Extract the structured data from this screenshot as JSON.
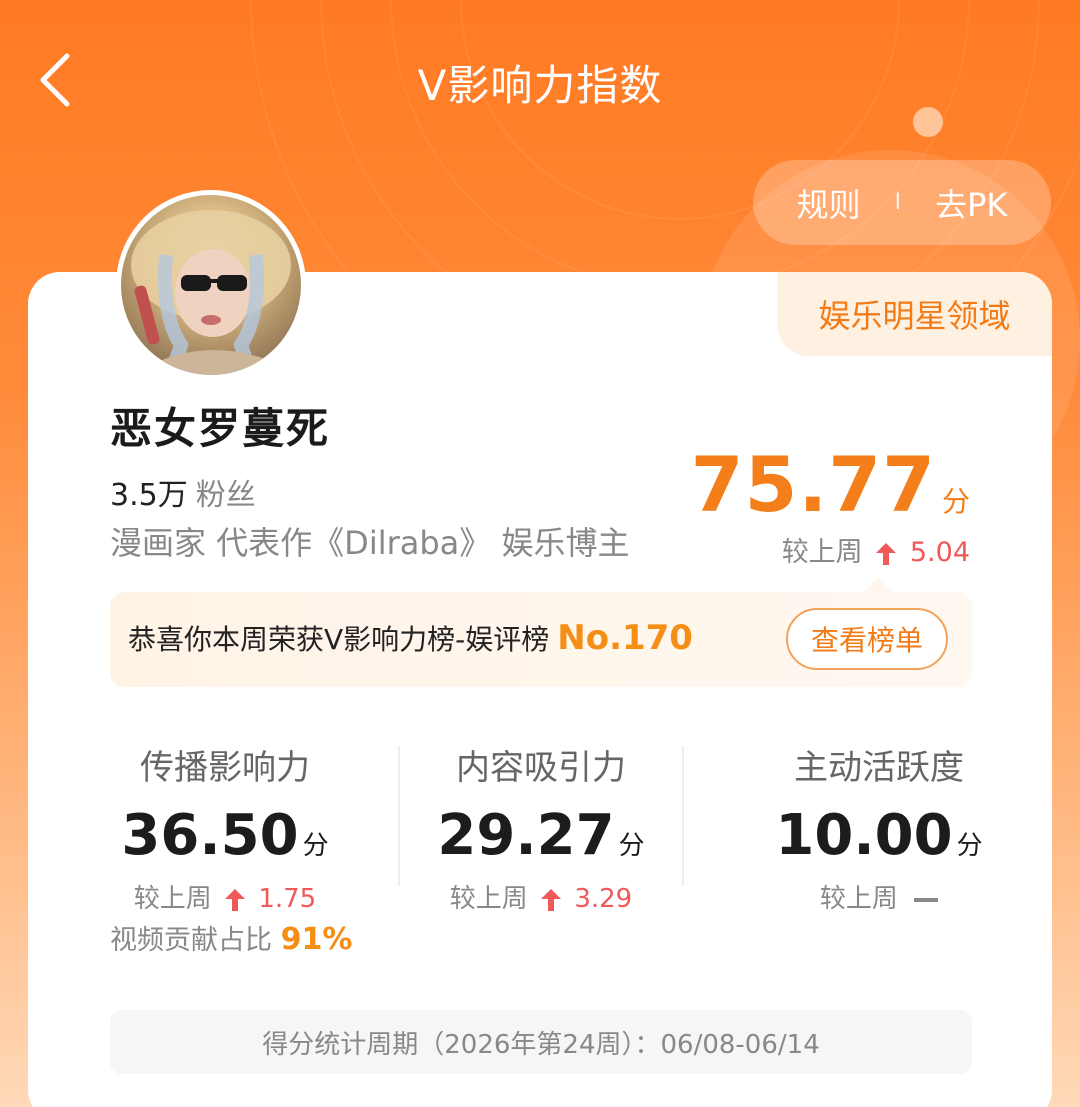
{
  "header": {
    "title": "V影响力指数"
  },
  "actions": {
    "rules": "规则",
    "separator": "I",
    "pk": "去PK"
  },
  "profile": {
    "domain": "娱乐明星领域",
    "name": "恶女罗蔓死",
    "fans_count": "3.5万",
    "fans_label": "粉丝",
    "bio": "漫画家 代表作《Dilraba》 娱乐博主"
  },
  "score": {
    "value": "75.77",
    "unit": "分",
    "delta_label": "较上周",
    "delta_value": "5.04"
  },
  "banner": {
    "text": "恭喜你本周荣获V影响力榜-娱评榜",
    "rank": "No.170",
    "button": "查看榜单"
  },
  "metrics": [
    {
      "label": "传播影响力",
      "score": "36.50",
      "unit": "分",
      "delta_label": "较上周",
      "delta": "1.75",
      "trend": "up"
    },
    {
      "label": "内容吸引力",
      "score": "29.27",
      "unit": "分",
      "delta_label": "较上周",
      "delta": "3.29",
      "trend": "up"
    },
    {
      "label": "主动活跃度",
      "score": "10.00",
      "unit": "分",
      "delta_label": "较上周",
      "delta": "",
      "trend": "flat"
    }
  ],
  "video_share": {
    "label": "视频贡献占比",
    "value": "91%"
  },
  "period": {
    "text": "得分统计周期（2026年第24周）：06/08-06/14"
  },
  "colors": {
    "accent": "#f47f1a",
    "up": "#f0585a",
    "header_bg": "#ff7a22"
  }
}
